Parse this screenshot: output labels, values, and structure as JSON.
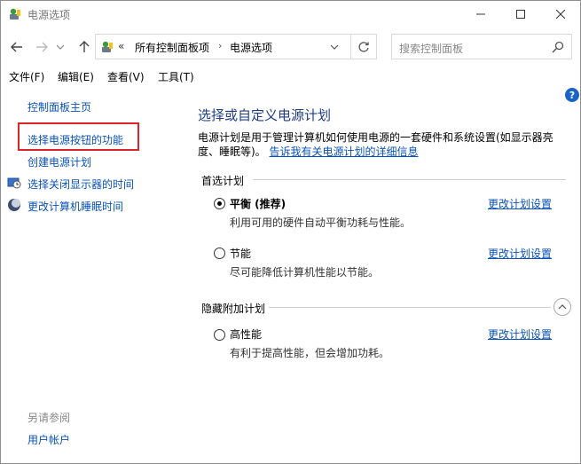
{
  "window": {
    "title": "电源选项"
  },
  "address": {
    "prefix": "«",
    "crumbs": [
      "所有控制面板项",
      "电源选项"
    ],
    "search_placeholder": "搜索控制面板"
  },
  "menu": [
    "文件(F)",
    "编辑(E)",
    "查看(V)",
    "工具(T)"
  ],
  "sidebar": {
    "items": [
      {
        "label": "控制面板主页"
      },
      {
        "label": "选择电源按钮的功能"
      },
      {
        "label": "创建电源计划"
      },
      {
        "label": "选择关闭显示器的时间"
      },
      {
        "label": "更改计算机睡眠时间"
      }
    ],
    "see_also_heading": "另请参阅",
    "see_also_items": [
      "用户帐户"
    ]
  },
  "main": {
    "title": "选择或自定义电源计划",
    "description": "电源计划是用于管理计算机如何使用电源的一套硬件和系统设置(如显示器亮度、睡眠等)。",
    "description_link": "告诉我有关电源计划的详细信息",
    "preferred_heading": "首选计划",
    "hidden_heading": "隐藏附加计划",
    "change_link": "更改计划设置",
    "plans": [
      {
        "name": "平衡 (推荐)",
        "desc": "利用可用的硬件自动平衡功耗与性能。",
        "selected": true
      },
      {
        "name": "节能",
        "desc": "尽可能降低计算机性能以节能。",
        "selected": false
      },
      {
        "name": "高性能",
        "desc": "有利于提高性能，但会增加功耗。",
        "selected": false
      }
    ]
  },
  "colors": {
    "link": "#0b52b6",
    "title": "#1e3e83",
    "highlight_border": "#d9252a",
    "help": "#1a65c4"
  }
}
